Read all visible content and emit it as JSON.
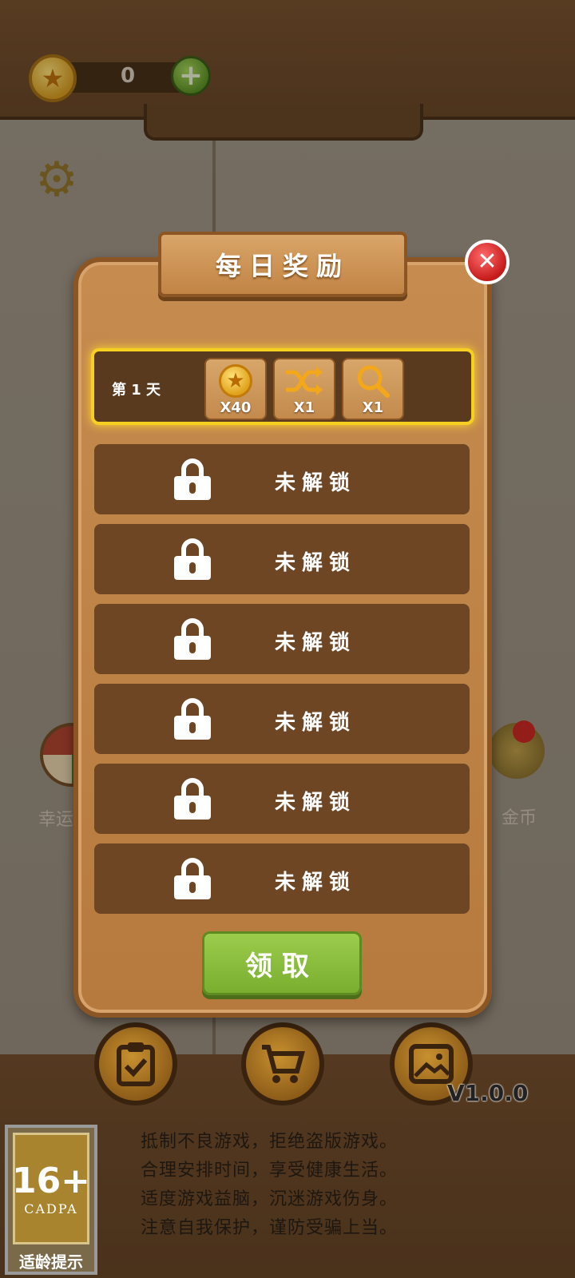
{
  "topbar": {
    "coin_count": "0",
    "coin_icon": "star-coin-icon",
    "add_icon": "plus-icon",
    "settings_icon": "gear-icon"
  },
  "side": {
    "left_label": "幸运",
    "right_label": "金币"
  },
  "modal": {
    "title": "每日奖励",
    "close_icon": "close-icon",
    "day1": {
      "label": "第 1 天",
      "rewards": [
        {
          "icon": "star-coin-icon",
          "qty": "X40"
        },
        {
          "icon": "shuffle-icon",
          "qty": "X1"
        },
        {
          "icon": "magnifier-icon",
          "qty": "X1"
        }
      ]
    },
    "locked_rows": [
      {
        "label": "未解锁"
      },
      {
        "label": "未解锁"
      },
      {
        "label": "未解锁"
      },
      {
        "label": "未解锁"
      },
      {
        "label": "未解锁"
      },
      {
        "label": "未解锁"
      }
    ],
    "claim_label": "领取"
  },
  "bottom": {
    "buttons": [
      {
        "icon": "clipboard-check-icon"
      },
      {
        "icon": "shopping-cart-icon"
      },
      {
        "icon": "picture-icon"
      }
    ],
    "version": "V1.0.0",
    "age_rating": {
      "number": "16+",
      "org": "CADPA",
      "tip": "适龄提示"
    },
    "notice_lines": [
      "抵制不良游戏，拒绝盗版游戏。",
      "合理安排时间，享受健康生活。",
      "适度游戏益脑，沉迷游戏伤身。",
      "注意自我保护，谨防受骗上当。"
    ]
  },
  "colors": {
    "wood_dark": "#5e3d21",
    "wood_panel": "#c68c4f",
    "highlight": "#f5d020",
    "claim_green": "#8cc040",
    "close_red": "#d92a2a"
  }
}
